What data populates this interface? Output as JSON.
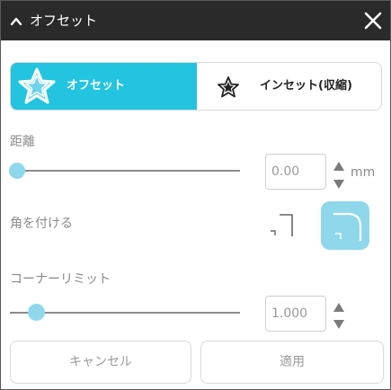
{
  "window": {
    "title": "オフセット",
    "collapse_icon": "chevron-up-icon",
    "close_icon": "close-icon"
  },
  "mode_toggle": {
    "selected": "offset",
    "offset": {
      "label": "オフセット",
      "icon": "star-outline-icon"
    },
    "inset": {
      "label": "インセット(収縮)",
      "icon": "star-inset-icon"
    }
  },
  "distance": {
    "label": "距離",
    "value": "0.00",
    "unit": "mm",
    "slider_value": 0
  },
  "corner": {
    "label": "角を付ける",
    "options": [
      "square-corner-icon",
      "rounded-corner-icon"
    ],
    "selected": "rounded"
  },
  "corner_limit": {
    "label": "コーナーリミット",
    "value": "1.000",
    "slider_value": 0.12
  },
  "buttons": {
    "cancel": "キャンセル",
    "apply": "適用"
  },
  "colors": {
    "accent": "#22c4e0",
    "accent_light": "#8fd8ec",
    "titlebar": "#2a2a2a"
  }
}
